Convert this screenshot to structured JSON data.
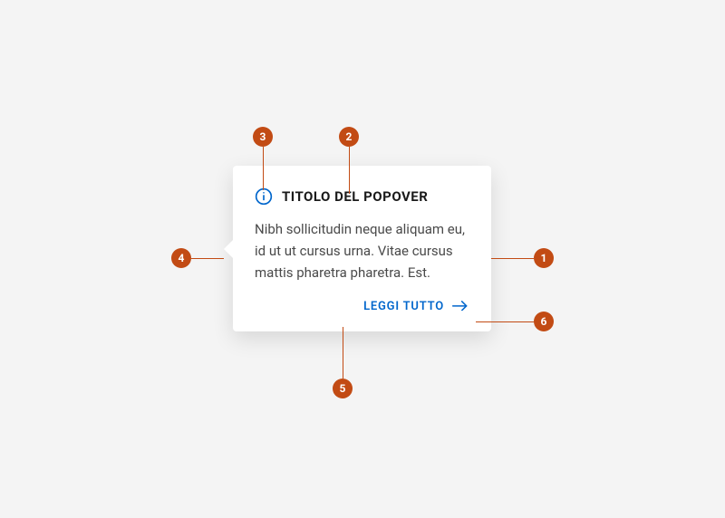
{
  "popover": {
    "title": "TITOLO DEL POPOVER",
    "body": "Nibh sollicitudin neque aliquam eu, id ut ut cursus urna. Vitae cursus mattis pharetra pharetra. Est.",
    "cta_label": "LEGGI TUTTO"
  },
  "markers": {
    "m1": "1",
    "m2": "2",
    "m3": "3",
    "m4": "4",
    "m5": "5",
    "m6": "6"
  },
  "colors": {
    "accent": "#0066cc",
    "marker": "#c24b14",
    "card_bg": "#ffffff",
    "page_bg": "#f4f4f4"
  }
}
